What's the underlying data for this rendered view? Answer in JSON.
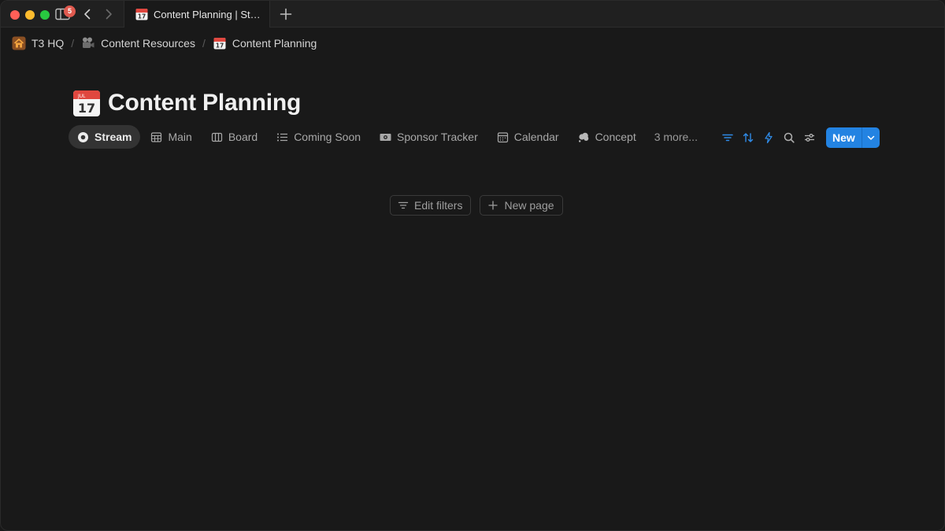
{
  "browser": {
    "tab_count_badge": "5",
    "active_tab_title": "Content Planning | St…",
    "new_tab_icon": "plus-icon"
  },
  "breadcrumb": [
    {
      "label": "T3 HQ",
      "icon": "house-icon"
    },
    {
      "label": "Content Resources",
      "icon": "film-camera-icon"
    },
    {
      "label": "Content Planning",
      "icon": "calendar-icon"
    }
  ],
  "page": {
    "title": "Content Planning",
    "icon": "calendar-icon"
  },
  "views": {
    "tabs": [
      {
        "label": "Stream",
        "icon": "record-icon",
        "active": true
      },
      {
        "label": "Main",
        "icon": "table-icon"
      },
      {
        "label": "Board",
        "icon": "board-icon"
      },
      {
        "label": "Coming Soon",
        "icon": "list-icon"
      },
      {
        "label": "Sponsor Tracker",
        "icon": "money-icon"
      },
      {
        "label": "Calendar",
        "icon": "calendar-view-icon"
      },
      {
        "label": "Concept",
        "icon": "thought-bubble-icon"
      }
    ],
    "more_label": "3 more..."
  },
  "toolbar": {
    "new_label": "New",
    "accent": "#2383e2"
  },
  "empty_state": {
    "edit_filters_label": "Edit filters",
    "new_page_label": "New page"
  }
}
